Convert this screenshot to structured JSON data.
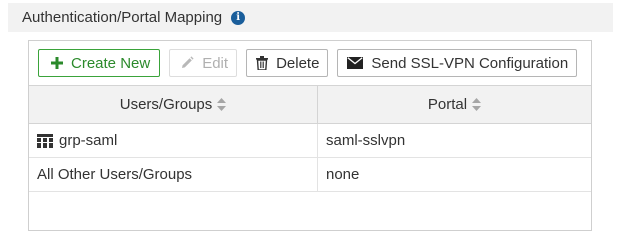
{
  "header": {
    "title": "Authentication/Portal Mapping",
    "info_icon": "info-circle-icon"
  },
  "toolbar": {
    "create_label": "Create New",
    "edit_label": "Edit",
    "delete_label": "Delete",
    "send_label": "Send SSL-VPN Configuration"
  },
  "table": {
    "columns": [
      {
        "label": "Users/Groups"
      },
      {
        "label": "Portal"
      }
    ],
    "rows": [
      {
        "users": "grp-saml",
        "portal": "saml-sslvpn",
        "icon": "user-group-icon"
      },
      {
        "users": "All Other Users/Groups",
        "portal": "none"
      }
    ]
  },
  "colors": {
    "accent_green": "#2b8a2b",
    "info_blue": "#1a5e9b",
    "header_bg": "#f2f2f2"
  }
}
